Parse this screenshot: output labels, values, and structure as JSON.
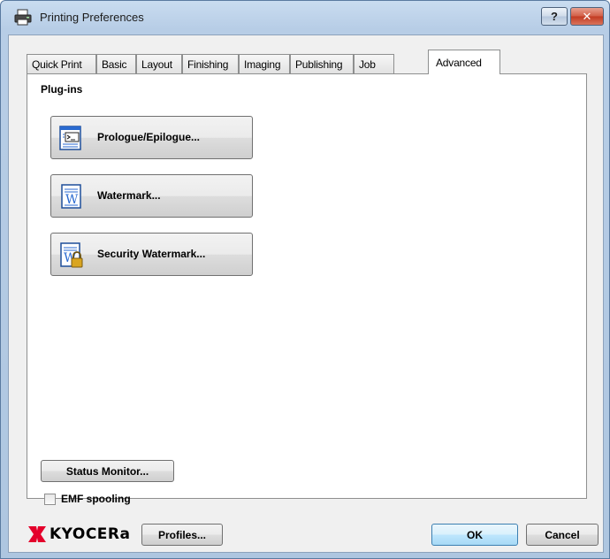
{
  "window": {
    "title": "Printing Preferences",
    "help_label": "?",
    "close_label": "✕"
  },
  "tabs": [
    {
      "label": "Quick Print"
    },
    {
      "label": "Basic"
    },
    {
      "label": "Layout"
    },
    {
      "label": "Finishing"
    },
    {
      "label": "Imaging"
    },
    {
      "label": "Publishing"
    },
    {
      "label": "Job"
    },
    {
      "label": "Advanced",
      "active": true
    }
  ],
  "plugins": {
    "group_label": "Plug-ins",
    "items": [
      {
        "label": "Prologue/Epilogue...",
        "icon": "prologue-icon"
      },
      {
        "label": "Watermark...",
        "icon": "watermark-icon"
      },
      {
        "label": "Security Watermark...",
        "icon": "security-watermark-icon"
      }
    ]
  },
  "status_monitor_label": "Status Monitor...",
  "emf_spooling": {
    "label": "EMF spooling",
    "checked": false
  },
  "footer": {
    "brand": "KYOCERa",
    "profiles_label": "Profiles...",
    "ok_label": "OK",
    "cancel_label": "Cancel"
  },
  "colors": {
    "brand_red": "#e4002b",
    "ok_border": "#3c7fb1"
  }
}
